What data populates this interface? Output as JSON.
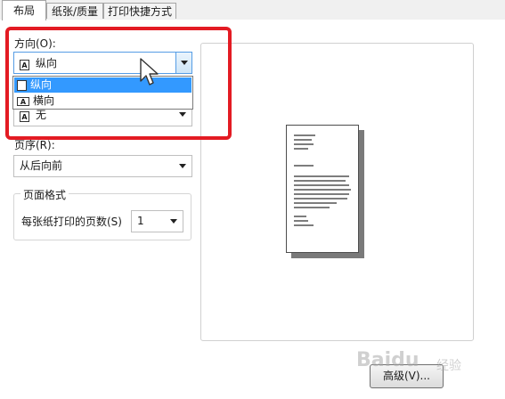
{
  "tabs": [
    {
      "label": "布局",
      "active": true
    },
    {
      "label": "纸张/质量",
      "active": false
    },
    {
      "label": "打印快捷方式",
      "active": false
    }
  ],
  "orientation": {
    "label": "方向(O):",
    "selected": "纵向",
    "options": [
      {
        "label": "纵向",
        "icon": "portrait-page-icon",
        "highlighted": true
      },
      {
        "label": "横向",
        "icon": "landscape-page-icon",
        "highlighted": false
      }
    ]
  },
  "duplex": {
    "value_partial": "无"
  },
  "page_order": {
    "label": "页序(R):",
    "value": "从后向前"
  },
  "page_format": {
    "legend": "页面格式",
    "pages_per_sheet_label": "每张纸打印的页数(S)",
    "pages_per_sheet_value": "1"
  },
  "advanced_button": "高级(V)...",
  "colors": {
    "highlight": "#e31b23",
    "selection": "#3399ff"
  },
  "watermark": {
    "brand": "Baidu",
    "sub": "经验"
  }
}
